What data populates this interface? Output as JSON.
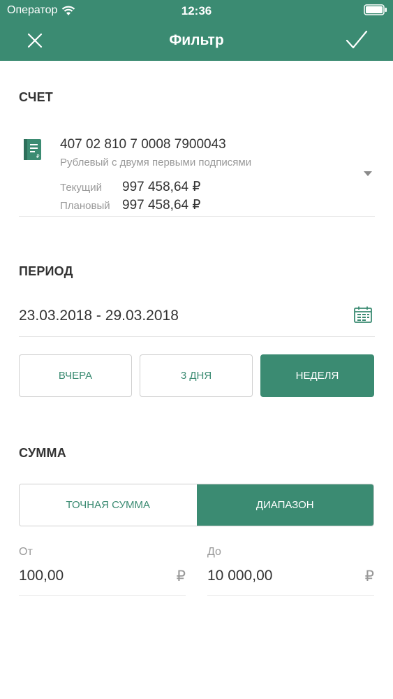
{
  "status_bar": {
    "carrier": "Оператор",
    "time": "12:36"
  },
  "nav": {
    "title": "Фильтр"
  },
  "account_section": {
    "title": "СЧЕТ",
    "number": "407 02 810 7 0008 7900043",
    "description": "Рублевый с двумя первыми подписями",
    "current_label": "Текущий",
    "current_value": "997 458,64 ₽",
    "planned_label": "Плановый",
    "planned_value": "997 458,64 ₽"
  },
  "period_section": {
    "title": "ПЕРИОД",
    "range": "23.03.2018 - 29.03.2018",
    "buttons": [
      {
        "label": "ВЧЕРА",
        "active": false
      },
      {
        "label": "3 ДНЯ",
        "active": false
      },
      {
        "label": "НЕДЕЛЯ",
        "active": true
      }
    ]
  },
  "amount_section": {
    "title": "СУММА",
    "options": [
      {
        "label": "ТОЧНАЯ СУММА",
        "active": false
      },
      {
        "label": "ДИАПАЗОН",
        "active": true
      }
    ],
    "from_label": "От",
    "from_value": "100,00",
    "to_label": "До",
    "to_value": "10 000,00",
    "currency": "₽"
  },
  "colors": {
    "accent": "#3b8b72",
    "text": "#333333",
    "muted": "#999999"
  }
}
